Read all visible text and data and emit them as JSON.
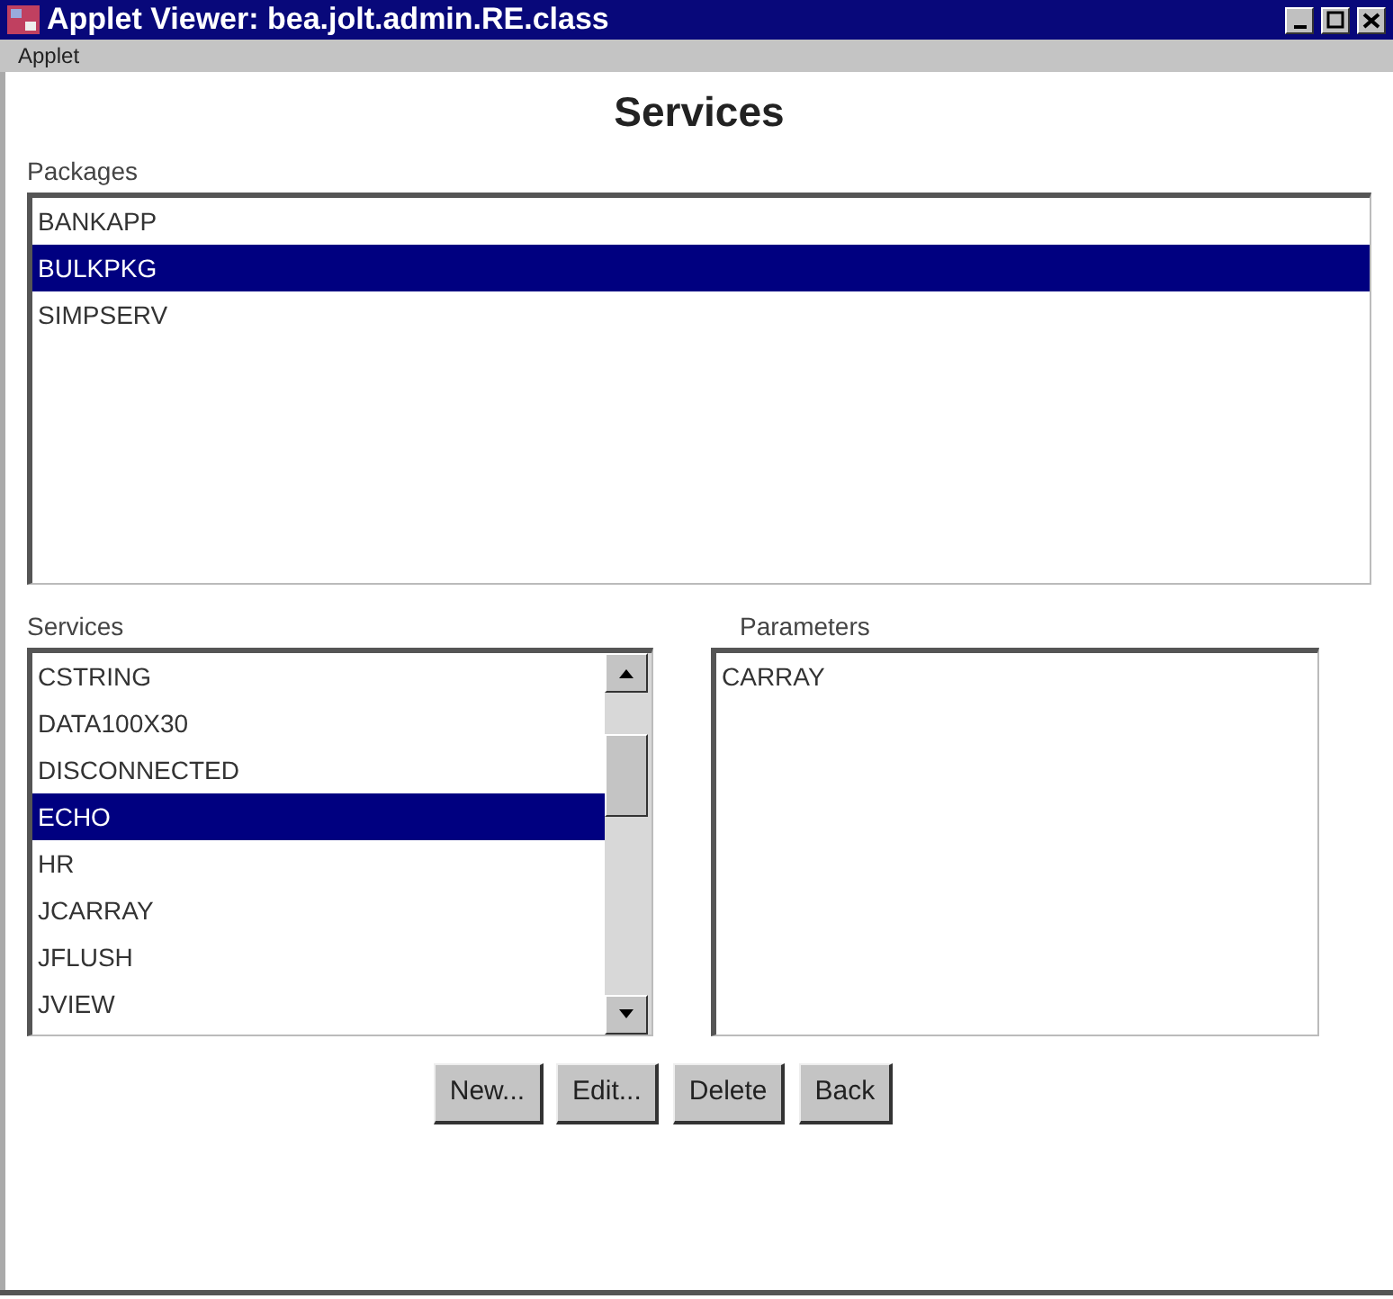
{
  "window": {
    "title": "Applet Viewer: bea.jolt.admin.RE.class"
  },
  "menu": [
    "Applet"
  ],
  "heading": "Services",
  "packages": {
    "label": "Packages",
    "items": [
      {
        "text": "BANKAPP",
        "selected": false
      },
      {
        "text": "BULKPKG",
        "selected": true
      },
      {
        "text": "SIMPSERV",
        "selected": false
      }
    ]
  },
  "services": {
    "label": "Services",
    "items": [
      {
        "text": "CSTRING",
        "selected": false
      },
      {
        "text": "DATA100X30",
        "selected": false
      },
      {
        "text": "DISCONNECTED",
        "selected": false
      },
      {
        "text": "ECHO",
        "selected": true
      },
      {
        "text": "HR",
        "selected": false
      },
      {
        "text": "JCARRAY",
        "selected": false
      },
      {
        "text": "JFLUSH",
        "selected": false
      },
      {
        "text": "JVIEW",
        "selected": false
      }
    ]
  },
  "parameters": {
    "label": "Parameters",
    "items": [
      {
        "text": "CARRAY",
        "selected": false
      }
    ]
  },
  "buttons": [
    "New...",
    "Edit...",
    "Delete",
    "Back"
  ]
}
